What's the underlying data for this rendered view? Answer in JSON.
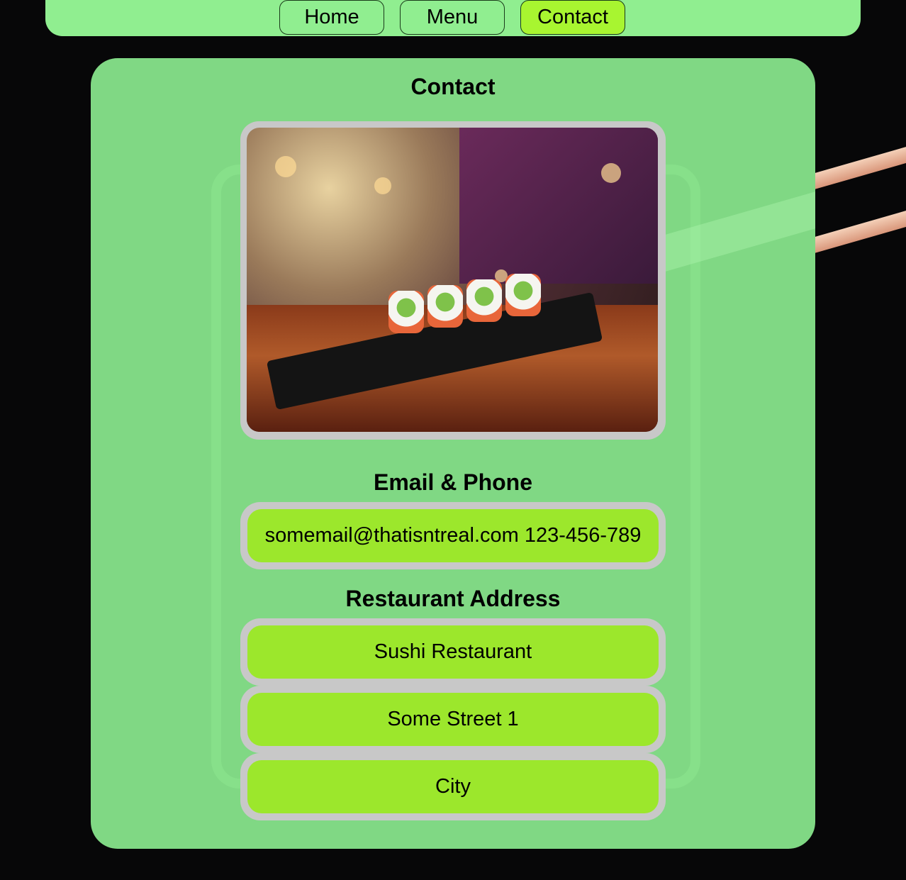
{
  "nav": {
    "items": [
      {
        "label": "Home"
      },
      {
        "label": "Menu"
      },
      {
        "label": "Contact"
      }
    ],
    "active": "Contact"
  },
  "contact": {
    "title": "Contact",
    "email_phone_heading": "Email & Phone",
    "email_phone": "somemail@thatisntreal.com 123-456-789",
    "address_heading": "Restaurant Address",
    "address": {
      "name": "Sushi Restaurant",
      "street": "Some Street 1",
      "city": "City"
    }
  },
  "colors": {
    "nav_bg": "#90ee90",
    "active_nav": "#a8f530",
    "card_bg": "#80d884",
    "pill_bg": "#9ce72c",
    "frame": "#c8c8c8",
    "page_bg": "#070708"
  }
}
